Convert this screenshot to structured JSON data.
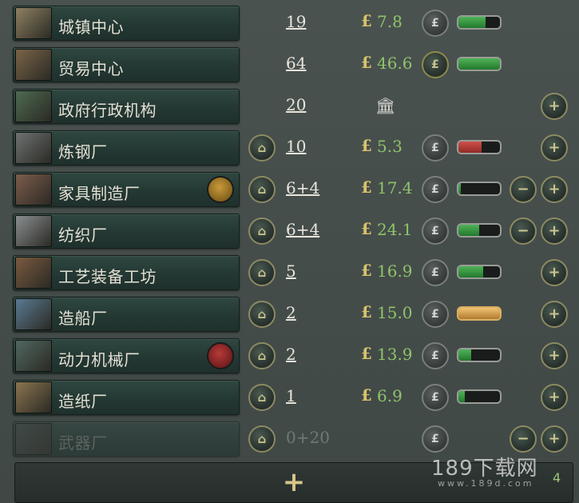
{
  "currency_symbol": "£",
  "buildings": [
    {
      "name": "城镇中心",
      "level": "19",
      "money": "7.8",
      "bar_fraction": 0.65,
      "bar_color": "green",
      "thumb": "#8f8062",
      "has_money_btn": true,
      "has_build_btn": false,
      "has_minus": false,
      "has_plus": false,
      "badge": null
    },
    {
      "name": "贸易中心",
      "level": "64",
      "money": "46.6",
      "bar_fraction": 1.0,
      "bar_color": "green",
      "thumb": "#7a6448",
      "has_money_btn": true,
      "has_build_btn": false,
      "has_minus": false,
      "has_plus": false,
      "badge": null,
      "money_gold": true
    },
    {
      "name": "政府行政机构",
      "level": "20",
      "money": "",
      "bar_fraction": null,
      "bar_color": null,
      "thumb": "#4e6a52",
      "has_money_btn": false,
      "has_build_btn": false,
      "has_minus": false,
      "has_plus": true,
      "badge": null,
      "bank_icon": true
    },
    {
      "name": "炼钢厂",
      "level": "10",
      "money": "5.3",
      "bar_fraction": 0.55,
      "bar_color": "red",
      "thumb": "#6e7272",
      "has_money_btn": true,
      "has_build_btn": true,
      "has_minus": false,
      "has_plus": true,
      "badge": null
    },
    {
      "name": "家具制造厂",
      "level": "6+4",
      "money": "17.4",
      "bar_fraction": 0.05,
      "bar_color": "green",
      "thumb": "#7c5c4c",
      "has_money_btn": true,
      "has_build_btn": true,
      "has_minus": true,
      "has_plus": true,
      "badge": "gold"
    },
    {
      "name": "纺织厂",
      "level": "6+4",
      "money": "24.1",
      "bar_fraction": 0.5,
      "bar_color": "green",
      "thumb": "#8a8e90",
      "has_money_btn": true,
      "has_build_btn": true,
      "has_minus": true,
      "has_plus": true,
      "badge": null
    },
    {
      "name": "工艺装备工坊",
      "level": "5",
      "money": "16.9",
      "bar_fraction": 0.6,
      "bar_color": "green",
      "thumb": "#7a5a40",
      "has_money_btn": true,
      "has_build_btn": true,
      "has_minus": false,
      "has_plus": true,
      "badge": null
    },
    {
      "name": "造船厂",
      "level": "2",
      "money": "15.0",
      "bar_fraction": 1.0,
      "bar_color": "orange",
      "thumb": "#5a7a92",
      "has_money_btn": true,
      "has_build_btn": true,
      "has_minus": false,
      "has_plus": true,
      "badge": null
    },
    {
      "name": "动力机械厂",
      "level": "2",
      "money": "13.9",
      "bar_fraction": 0.3,
      "bar_color": "green",
      "thumb": "#506860",
      "has_money_btn": true,
      "has_build_btn": true,
      "has_minus": false,
      "has_plus": true,
      "badge": "red"
    },
    {
      "name": "造纸厂",
      "level": "1",
      "money": "6.9",
      "bar_fraction": 0.15,
      "bar_color": "green",
      "thumb": "#8a7450",
      "has_money_btn": true,
      "has_build_btn": true,
      "has_minus": false,
      "has_plus": true,
      "badge": null
    },
    {
      "name": "武器厂",
      "level": "0+20",
      "money": "",
      "bar_fraction": null,
      "bar_color": null,
      "thumb": "#3e4a46",
      "has_money_btn": true,
      "has_build_btn": true,
      "has_minus": true,
      "has_plus": true,
      "badge": null,
      "disabled": true
    }
  ],
  "add_row": {
    "plus": "+",
    "count": "4"
  },
  "watermark": {
    "main": "189下载网",
    "sub": "www.189d.com"
  },
  "colors": {
    "money_green": "#8fc46a",
    "coin_gold": "#d7c36a",
    "bar_green": "#4fb356",
    "bar_red": "#d0504a",
    "bar_orange": "#f0c370"
  }
}
